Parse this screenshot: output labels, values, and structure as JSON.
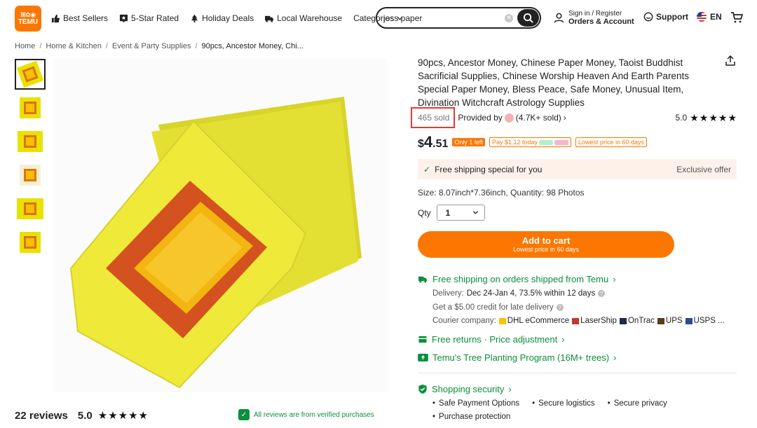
{
  "header": {
    "logo_line1": "ꕤ✿◉",
    "logo_line2": "TEMU",
    "nav": [
      "Best Sellers",
      "5-Star Rated",
      "Holiday Deals",
      "Local Warehouse",
      "Categories"
    ],
    "search_value": "joss paper",
    "account_line1": "Sign in / Register",
    "account_line2": "Orders & Account",
    "support": "Support",
    "language": "EN"
  },
  "breadcrumb": [
    "Home",
    "Home & Kitchen",
    "Event & Party Supplies",
    "90pcs, Ancestor Money, Chi..."
  ],
  "product": {
    "title": "90pcs, Ancestor Money, Chinese Paper Money, Taoist Buddhist Sacrificial Supplies, Chinese Worship Heaven And Earth Parents Special Paper Money, Bless Peace, Safe Money, Unusual Item, Divination Witchcraft Astrology Supplies",
    "sold": "465 sold",
    "provided_by": "Provided by",
    "store_sold": "(4.7K+ sold)",
    "rating": "5.0",
    "price_currency": "$",
    "price_whole": "4",
    "price_cents": ".51",
    "tag_only_left": "Only 1 left",
    "tag_pay_later": "Pay $1.12 today",
    "tag_lowest": "Lowest price in 60 days",
    "free_shipping": "Free shipping special for you",
    "exclusive": "Exclusive offer",
    "size": "Size: 8.07inch*7.36inch, Quantity: 98 Photos",
    "qty_label": "Qty",
    "qty_value": "1",
    "add_cart": "Add to cart",
    "add_cart_sub": "Lowest price in 60 days"
  },
  "shipping": {
    "title": "Free shipping on orders shipped from Temu",
    "delivery_label": "Delivery:",
    "delivery_value": "Dec 24-Jan 4, 73.5% within 12 days",
    "credit": "Get a $5.00 credit for late delivery",
    "courier_label": "Courier company:",
    "couriers": [
      "DHL eCommerce",
      "LaserShip",
      "OnTrac",
      "UPS",
      "USPS ..."
    ]
  },
  "returns": "Free returns · Price adjustment",
  "tree": "Temu's Tree Planting Program (16M+ trees)",
  "security": {
    "title": "Shopping security",
    "items": [
      "Safe Payment Options",
      "Secure logistics",
      "Secure privacy",
      "Purchase protection"
    ]
  },
  "reviews": {
    "count": "22 reviews",
    "score": "5.0",
    "verified": "All reviews are from verified purchases"
  },
  "colors": {
    "accent": "#fb7701",
    "green": "#0a8f3c",
    "highlight": "#e53935"
  }
}
